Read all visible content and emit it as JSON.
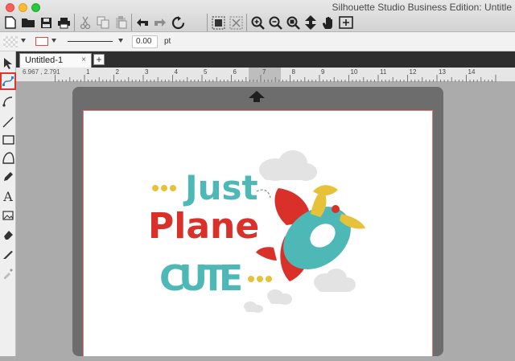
{
  "window": {
    "title": "Silhouette Studio Business Edition: Untitle"
  },
  "toolbar": {
    "buttons": [
      "new",
      "open",
      "save",
      "print",
      "cut",
      "copy",
      "paste",
      "undo",
      "redo",
      "refresh",
      "group",
      "ungroup",
      "zoom-in",
      "zoom-out",
      "zoom-fit",
      "pan-move",
      "hand",
      "fit-page"
    ]
  },
  "line_settings": {
    "line_width_value": "0.00",
    "line_width_unit": "pt"
  },
  "tabs": [
    {
      "label": "Untitled-1",
      "close": "×"
    }
  ],
  "tab_add_label": "+",
  "ruler": {
    "coordinates": "6.967 , 2.791",
    "ticks": [
      "1",
      "2",
      "3",
      "4",
      "5",
      "6",
      "7",
      "8",
      "9",
      "10",
      "11",
      "12",
      "13",
      "14"
    ]
  },
  "artwork": {
    "line1": "Just",
    "line2": "Plane",
    "line3": "CUTE",
    "colors": {
      "teal": "#4eb8b7",
      "red": "#d9302a",
      "yellow": "#e6c23a",
      "cloud": "#e3e3e3"
    }
  },
  "colors": {
    "highlight": "#e0352b",
    "tab_bar": "#2e2e2e",
    "mat": "#6d6d6d"
  }
}
